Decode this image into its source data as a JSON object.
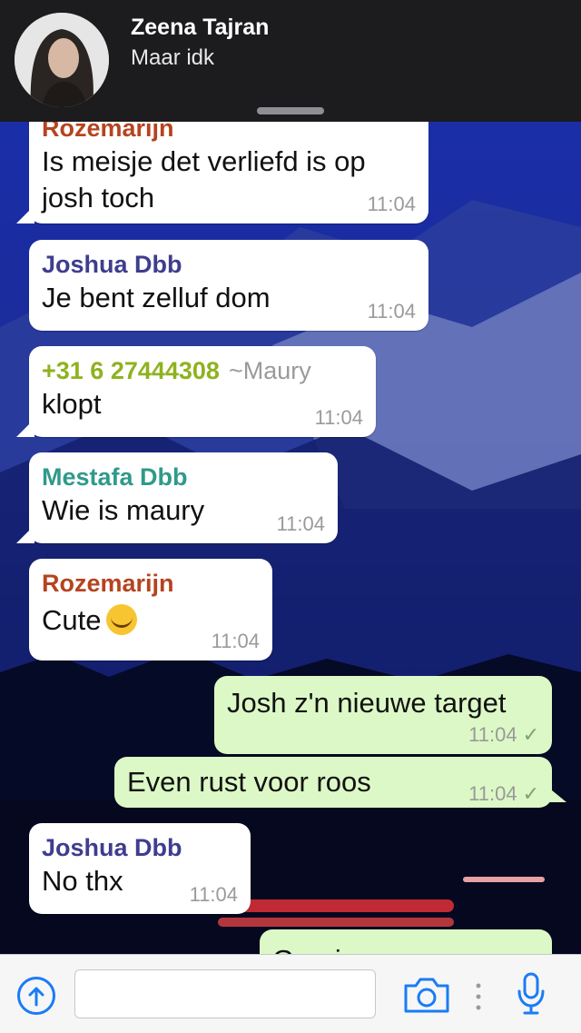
{
  "header": {
    "contact_name": "Zeena Tajran",
    "status": "Maar idk"
  },
  "messages": [
    {
      "direction": "in",
      "sender": "Rozemarijn",
      "text_lines": [
        "Is meisje det verliefd is op",
        "josh toch"
      ],
      "time": "11:04"
    },
    {
      "direction": "in",
      "sender": "Joshua Dbb",
      "text_lines": [
        "Je bent zelluf dom"
      ],
      "time": "11:04"
    },
    {
      "direction": "in",
      "sender": "+31 6 27444308",
      "alias": "~Maury",
      "text_lines": [
        "klopt"
      ],
      "time": "11:04"
    },
    {
      "direction": "in",
      "sender": "Mestafa Dbb",
      "text_lines": [
        "Wie is maury"
      ],
      "time": "11:04"
    },
    {
      "direction": "in",
      "sender": "Rozemarijn",
      "text_lines": [
        "Cute"
      ],
      "emoji": "smiling-blush-emoji",
      "time": "11:04"
    },
    {
      "direction": "out",
      "text_lines": [
        "Josh z'n nieuwe target"
      ],
      "time": "11:04",
      "ticks": "✓"
    },
    {
      "direction": "out",
      "text_lines": [
        "Even rust voor roos"
      ],
      "time": "11:04",
      "ticks": "✓"
    },
    {
      "direction": "in",
      "sender": "Joshua Dbb",
      "text_lines": [
        "No thx"
      ],
      "time": "11:04"
    },
    {
      "direction": "out",
      "text_lines": [
        "Grapje xx"
      ],
      "time": ""
    }
  ],
  "sender_colors": {
    "Rozemarijn": "#b5441f",
    "Joshua Dbb": "#3f3d8e",
    "+31 6 27444308": "#8fb21f",
    "Mestafa Dbb": "#2f9a8a"
  },
  "input": {
    "placeholder": "",
    "icons": [
      "upload-arrow-icon",
      "camera-icon",
      "more-dots-icon",
      "microphone-icon"
    ]
  },
  "colors": {
    "accent": "#1a7cf5",
    "outgoing_bubble": "#dcf8c6",
    "incoming_bubble": "#ffffff"
  }
}
